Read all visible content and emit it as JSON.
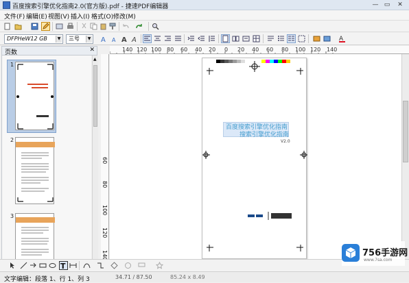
{
  "window": {
    "title": "百度搜索引擎优化指南2.0(官方版).pdf - 捷速PDF编辑器",
    "minimize": "—",
    "restore": "▭",
    "close": "✕"
  },
  "menu": [
    "文件(F)",
    "编辑(E)",
    "视图(V)",
    "插入(I)",
    "格式(O)",
    "修改(M)"
  ],
  "font_combo": {
    "family": "DFPHeW12 GB",
    "size": "三号"
  },
  "panel": {
    "title": "页数",
    "close": "✕"
  },
  "pages": [
    {
      "num": "1",
      "selected": true
    },
    {
      "num": "2",
      "selected": false
    },
    {
      "num": "3",
      "selected": false
    }
  ],
  "ruler": [
    "140",
    "120",
    "100",
    "80",
    "60",
    "40",
    "20",
    "0",
    "20",
    "40",
    "60",
    "80",
    "100",
    "120",
    "140"
  ],
  "vruler": [
    "60",
    "80",
    "100",
    "120",
    "140"
  ],
  "doc": {
    "title_line1": "百度搜索引擎优化指南",
    "title_line2": "搜索引擎优化指南",
    "version": "V2.0"
  },
  "status": {
    "text": "文字编辑：段落 1、行 1、列 3",
    "coords": "34.71 / 87.50",
    "size": "85.24 x 8.49"
  },
  "watermark": {
    "badge": "756手游网",
    "url": "www.7sa.com"
  }
}
